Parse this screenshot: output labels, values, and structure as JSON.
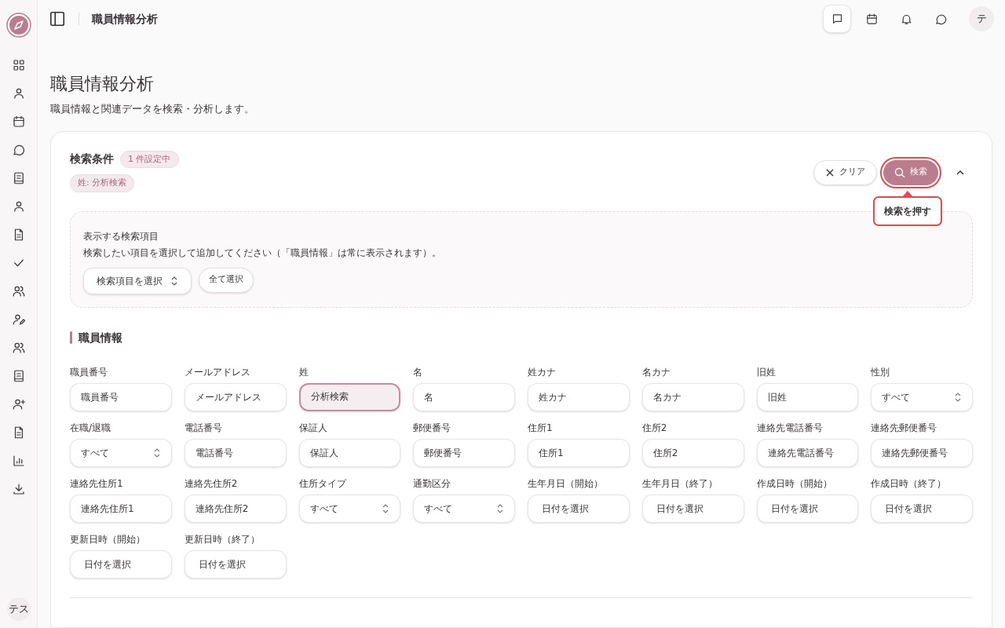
{
  "sidebar": {
    "avatar": "テス"
  },
  "header": {
    "title": "職員情報分析",
    "icons": [
      {
        "selected": true
      },
      {
        "selected": false
      },
      {
        "selected": false
      },
      {
        "selected": false
      }
    ],
    "avatar": "テ"
  },
  "page": {
    "title": "職員情報分析",
    "subtitle": "職員情報と関連データを検索・分析します。"
  },
  "search_panel": {
    "title": "検索条件",
    "count_badge": "1 件設定中",
    "filter_chips": [
      "姓: 分析検索"
    ],
    "clear_button": "クリア",
    "search_button": {
      "label": "検索",
      "highlighted": true
    },
    "expanded": true,
    "callout": "検索を押す",
    "field_picker": {
      "title": "表示する検索項目",
      "description": "検索したい項目を選択して追加してください（「職員情報」は常に表示されます）。",
      "select": "検索項目を選択",
      "select_all": "全て選択"
    },
    "section_title": "職員情報",
    "fields": [
      {
        "kind": "text",
        "label": "職員番号",
        "placeholder": "職員番号"
      },
      {
        "kind": "text",
        "label": "メールアドレス",
        "placeholder": "メールアドレス"
      },
      {
        "kind": "text",
        "label": "姓",
        "value": "分析検索"
      },
      {
        "kind": "text",
        "label": "名",
        "placeholder": "名"
      },
      {
        "kind": "text",
        "label": "姓カナ",
        "placeholder": "姓カナ"
      },
      {
        "kind": "text",
        "label": "名カナ",
        "placeholder": "名カナ"
      },
      {
        "kind": "text",
        "label": "旧姓",
        "placeholder": "旧姓"
      },
      {
        "kind": "select",
        "label": "性別",
        "value": "すべて"
      },
      {
        "kind": "select",
        "label": "在職/退職",
        "value": "すべて"
      },
      {
        "kind": "text",
        "label": "電話番号",
        "placeholder": "電話番号"
      },
      {
        "kind": "text",
        "label": "保証人",
        "placeholder": "保証人"
      },
      {
        "kind": "text",
        "label": "郵便番号",
        "placeholder": "郵便番号"
      },
      {
        "kind": "text",
        "label": "住所1",
        "placeholder": "住所1"
      },
      {
        "kind": "text",
        "label": "住所2",
        "placeholder": "住所2"
      },
      {
        "kind": "text",
        "label": "連絡先電話番号",
        "placeholder": "連絡先電話番号"
      },
      {
        "kind": "text",
        "label": "連絡先郵便番号",
        "placeholder": "連絡先郵便番号"
      },
      {
        "kind": "text",
        "label": "連絡先住所1",
        "placeholder": "連絡先住所1"
      },
      {
        "kind": "text",
        "label": "連絡先住所2",
        "placeholder": "連絡先住所2"
      },
      {
        "kind": "select",
        "label": "住所タイプ",
        "value": "すべて"
      },
      {
        "kind": "select",
        "label": "通勤区分",
        "value": "すべて"
      },
      {
        "kind": "date",
        "label": "生年月日（開始）",
        "placeholder": "日付を選択"
      },
      {
        "kind": "date",
        "label": "生年月日（終了）",
        "placeholder": "日付を選択"
      },
      {
        "kind": "date",
        "label": "作成日時（開始）",
        "placeholder": "日付を選択"
      },
      {
        "kind": "date",
        "label": "作成日時（終了）",
        "placeholder": "日付を選択"
      },
      {
        "kind": "date",
        "label": "更新日時（開始）",
        "placeholder": "日付を選択"
      },
      {
        "kind": "date",
        "label": "更新日時（終了）",
        "placeholder": "日付を選択"
      }
    ]
  }
}
